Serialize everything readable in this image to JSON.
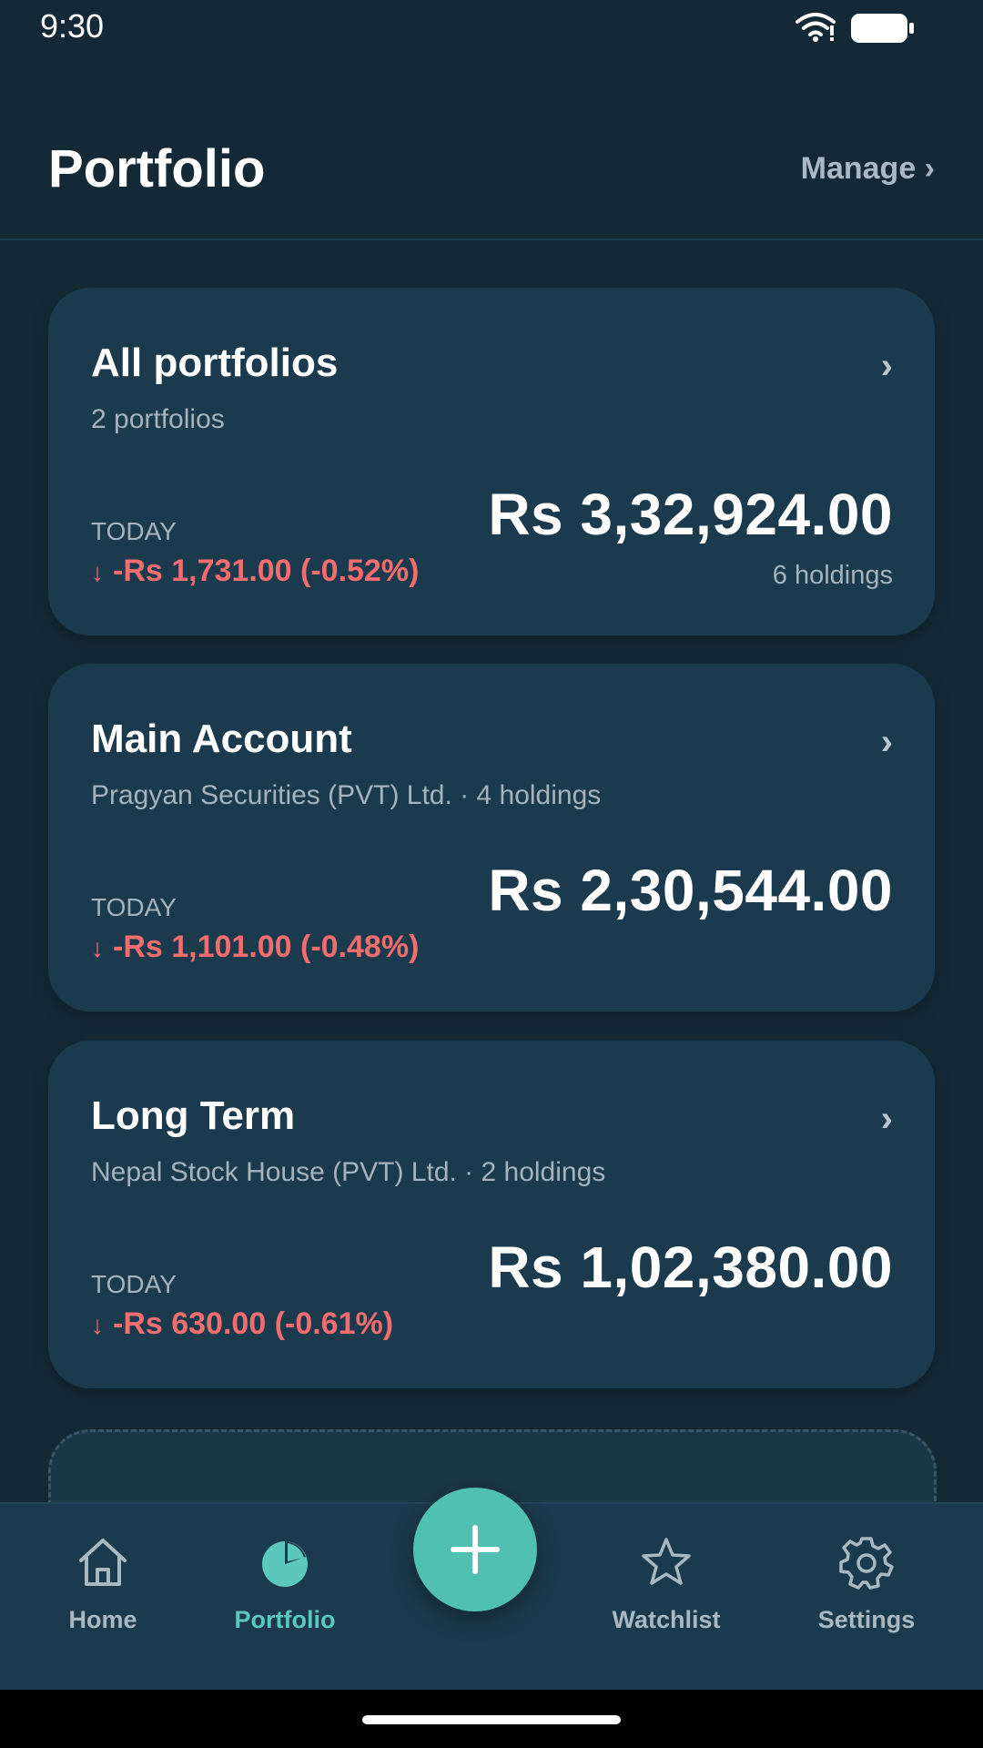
{
  "status_bar": {
    "time": "9:30",
    "wifi_icon": "wifi-icon",
    "battery_icon": "battery-icon"
  },
  "header": {
    "title": "Portfolio",
    "manage_label": "Manage ›"
  },
  "cards": [
    {
      "title": "All portfolios",
      "subtitle": "2 portfolios",
      "today_label": "TODAY",
      "change_arrow": "↓",
      "change": "-Rs 1,731.00 (-0.52%)",
      "value": "Rs 3,32,924.00",
      "holdings": "6 holdings",
      "chevron": "›"
    },
    {
      "title": "Main Account",
      "subtitle": "Pragyan Securities (PVT) Ltd. · 4 holdings",
      "today_label": "TODAY",
      "change_arrow": "↓",
      "change": "-Rs 1,101.00 (-0.48%)",
      "value": "Rs 2,30,544.00",
      "chevron": "›"
    },
    {
      "title": "Long Term",
      "subtitle": "Nepal Stock House (PVT) Ltd. · 2 holdings",
      "today_label": "TODAY",
      "change_arrow": "↓",
      "change": "-Rs 630.00 (-0.61%)",
      "value": "Rs 1,02,380.00",
      "chevron": "›"
    }
  ],
  "nav": {
    "items": [
      {
        "label": "Home",
        "icon": "home-icon"
      },
      {
        "label": "Portfolio",
        "icon": "pie-chart-icon",
        "active": true
      },
      {
        "label": "Watchlist",
        "icon": "star-icon"
      },
      {
        "label": "Settings",
        "icon": "gear-icon"
      }
    ],
    "fab_icon": "plus-icon"
  },
  "colors": {
    "background": "#132a36",
    "card": "#1c3a4d",
    "accent": "#4fc0b2",
    "negative": "#f26d6d",
    "muted_text": "#a4b3bd"
  }
}
